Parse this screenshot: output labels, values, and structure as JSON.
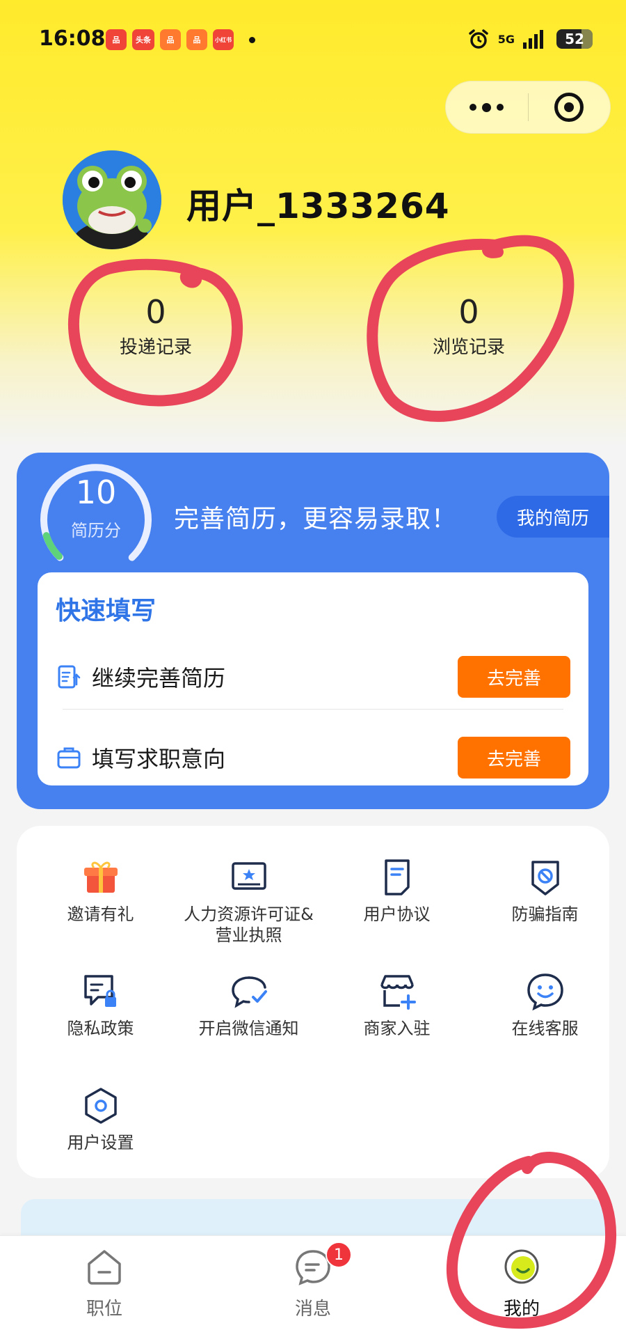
{
  "status_bar": {
    "time": "16:08",
    "apps": [
      "品",
      "头条",
      "品",
      "品",
      "小红书"
    ],
    "network": "5G",
    "battery": "52"
  },
  "capsule": {
    "more_icon": "more-dots-icon",
    "close_icon": "target-icon"
  },
  "profile": {
    "username": "用户_1333264",
    "avatar_icon": "frog-avatar"
  },
  "stats": {
    "delivery": {
      "value": "0",
      "label": "投递记录"
    },
    "browse": {
      "value": "0",
      "label": "浏览记录"
    }
  },
  "resume": {
    "score": "10",
    "score_label": "简历分",
    "score_progress": 0.1,
    "slogan": "完善简历，更容易录取！",
    "my_resume_label": "我的简历",
    "quick_title": "快速填写",
    "rows": [
      {
        "icon": "resume-edit-icon",
        "label": "继续完善简历",
        "button": "去完善"
      },
      {
        "icon": "briefcase-icon",
        "label": "填写求职意向",
        "button": "去完善"
      }
    ]
  },
  "menu": [
    {
      "icon": "gift-icon",
      "label": "邀请有礼"
    },
    {
      "icon": "certificate-icon",
      "label": "人力资源许可证&营业执照"
    },
    {
      "icon": "document-icon",
      "label": "用户协议"
    },
    {
      "icon": "shield-icon",
      "label": "防骗指南"
    },
    {
      "icon": "privacy-lock-icon",
      "label": "隐私政策"
    },
    {
      "icon": "chat-check-icon",
      "label": "开启微信通知"
    },
    {
      "icon": "store-add-icon",
      "label": "商家入驻"
    },
    {
      "icon": "support-chat-icon",
      "label": "在线客服"
    },
    {
      "icon": "settings-hexagon-icon",
      "label": "用户设置"
    }
  ],
  "tabbar": {
    "jobs": {
      "icon": "house-icon",
      "label": "职位"
    },
    "messages": {
      "icon": "message-icon",
      "label": "消息",
      "badge": "1"
    },
    "me": {
      "icon": "smile-icon",
      "label": "我的"
    }
  },
  "colors": {
    "header_yellow": "#ffea2c",
    "resume_blue": "#4781f0",
    "button_orange": "#ff7200",
    "annotation_red": "#e8455a",
    "badge_red": "#f0343c"
  }
}
